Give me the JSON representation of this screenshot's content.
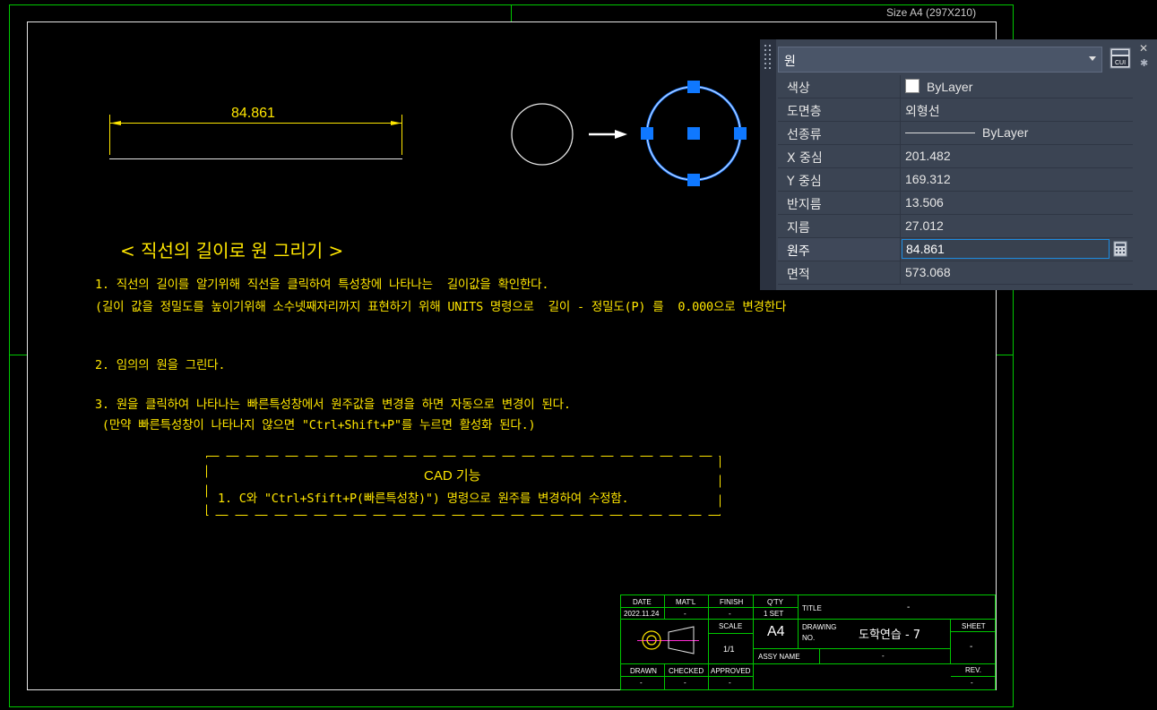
{
  "sheet": {
    "size_label": "Size A4 (297X210)"
  },
  "dimension": {
    "value": "84.861"
  },
  "colors": {
    "yellow": "#ffe600",
    "green": "#00c800",
    "grip_blue": "#0f78ff"
  },
  "heading": "< 직선의 길이로 원 그리기 >",
  "notes": {
    "line1": "1. 직선의 길이를 알기위해 직선을 클릭하여 특성창에 나타나는  길이값을 확인한다.",
    "line2": "(길이 값을 정밀도를 높이기위해 소수넷째자리까지 표현하기 위해 UNITS 명령으로  길이 - 정밀도(P) 를  0.000으로 변경한다",
    "line3": "2. 임의의 원을 그린다.",
    "line4": "3. 원을 클릭하여 나타나는 빠른특성창에서 원주값을 변경을 하면 자동으로 변경이 된다.",
    "line5": " (만약 빠른특성창이 나타나지 않으면 \"Ctrl+Shift+P\"를 누르면 활성화 된다.)"
  },
  "cad_box": {
    "title": "CAD 기능",
    "line": "1. C와 \"Ctrl+Sfift+P(빠른특성창)\") 명령으로 원주를 변경하여 수정함."
  },
  "title_block": {
    "date_label": "DATE",
    "date_value": "2022.11.24",
    "matl_label": "MAT'L",
    "matl_value": "-",
    "finish_label": "FINISH",
    "finish_value": "-",
    "qty_label": "Q'TY",
    "qty_value": "1 SET",
    "title_label": "TITLE",
    "title_value": "-",
    "scale_label": "SCALE",
    "scale_value": "1/1",
    "paper": "A4",
    "drawing_no_label1": "DRAWING",
    "drawing_no_label2": "NO.",
    "drawing_no_value": "도학연습 - 7",
    "sheet_label": "SHEET",
    "sheet_value": "-",
    "assy_label": "ASSY NAME",
    "assy_value": "-",
    "drawn_label": "DRAWN",
    "drawn_value": "-",
    "checked_label": "CHECKED",
    "checked_value": "-",
    "approved_label": "APPROVED",
    "approved_value": "-",
    "rev_label": "REV.",
    "rev_value": "-"
  },
  "properties": {
    "object_type": "원",
    "rows": [
      {
        "name": "색상",
        "value": "ByLayer"
      },
      {
        "name": "도면층",
        "value": "외형선"
      },
      {
        "name": "선종류",
        "value": "ByLayer"
      },
      {
        "name": "X 중심",
        "value": "201.482"
      },
      {
        "name": "Y 중심",
        "value": "169.312"
      },
      {
        "name": "반지름",
        "value": "13.506"
      },
      {
        "name": "지름",
        "value": "27.012"
      },
      {
        "name": "원주",
        "value": "84.861"
      },
      {
        "name": "면적",
        "value": "573.068"
      }
    ],
    "close_glyph": "✕",
    "settings_glyph": "✱"
  }
}
